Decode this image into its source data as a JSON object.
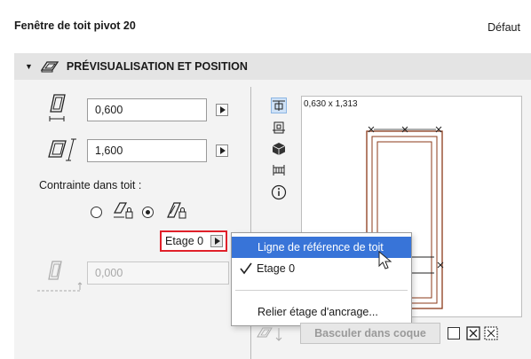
{
  "header": {
    "title": "Fenêtre de toit pivot 20",
    "default_label": "Défaut"
  },
  "section": {
    "title": "PRÉVISUALISATION ET POSITION",
    "icon": "skylight-icon"
  },
  "fields": {
    "width_value": "0,600",
    "height_value": "1,600",
    "offset_value": "0,000"
  },
  "constraint": {
    "label": "Contrainte dans toit :",
    "selected": "option-2"
  },
  "etage": {
    "label": "Etage 0"
  },
  "preview": {
    "dimensions": "0,630 x 1,313"
  },
  "menu": {
    "items": [
      {
        "label": "Ligne de référence de toit",
        "highlighted": true,
        "checked": false
      },
      {
        "label": "Etage 0",
        "highlighted": false,
        "checked": true
      },
      {
        "label": "Relier étage d'ancrage...",
        "highlighted": false,
        "checked": false
      }
    ]
  },
  "bottom": {
    "basculer_label": "Basculer dans coque"
  },
  "colors": {
    "highlight": "#3874d8",
    "emphasis_border": "#e0202a",
    "preview_lines": "#8b3a1a"
  }
}
